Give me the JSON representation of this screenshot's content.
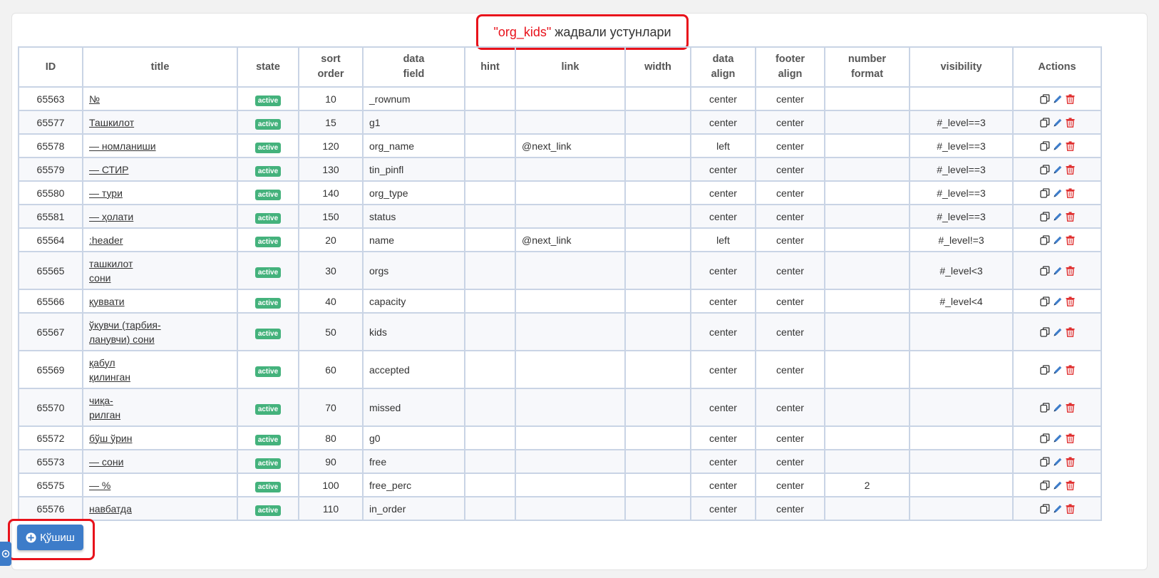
{
  "header": {
    "title_highlight": "\"org_kids\"",
    "title_rest": " жадвали устунлари"
  },
  "columns": [
    "ID",
    "title",
    "state",
    "sort\norder",
    "data\nfield",
    "hint",
    "link",
    "width",
    "data\nalign",
    "footer\nalign",
    "number\nformat",
    "visibility",
    "Actions"
  ],
  "rows": [
    {
      "id": "65563",
      "title": "№",
      "state": "active",
      "sort": "10",
      "field": "_rownum",
      "hint": "",
      "link": "",
      "width": "",
      "data_align": "center",
      "footer_align": "center",
      "number_format": "",
      "visibility": ""
    },
    {
      "id": "65577",
      "title": "Ташкилот",
      "state": "active",
      "sort": "15",
      "field": "g1",
      "hint": "",
      "link": "",
      "width": "",
      "data_align": "center",
      "footer_align": "center",
      "number_format": "",
      "visibility": "#_level==3"
    },
    {
      "id": "65578",
      "title": "— номланиши",
      "state": "active",
      "sort": "120",
      "field": "org_name",
      "hint": "",
      "link": "@next_link",
      "width": "",
      "data_align": "left",
      "footer_align": "center",
      "number_format": "",
      "visibility": "#_level==3"
    },
    {
      "id": "65579",
      "title": "— СТИР",
      "state": "active",
      "sort": "130",
      "field": "tin_pinfl",
      "hint": "",
      "link": "",
      "width": "",
      "data_align": "center",
      "footer_align": "center",
      "number_format": "",
      "visibility": "#_level==3"
    },
    {
      "id": "65580",
      "title": "— тури",
      "state": "active",
      "sort": "140",
      "field": "org_type",
      "hint": "",
      "link": "",
      "width": "",
      "data_align": "center",
      "footer_align": "center",
      "number_format": "",
      "visibility": "#_level==3"
    },
    {
      "id": "65581",
      "title": "— ҳолати",
      "state": "active",
      "sort": "150",
      "field": "status",
      "hint": "",
      "link": "",
      "width": "",
      "data_align": "center",
      "footer_align": "center",
      "number_format": "",
      "visibility": "#_level==3"
    },
    {
      "id": "65564",
      "title": ":header",
      "state": "active",
      "sort": "20",
      "field": "name",
      "hint": "",
      "link": "@next_link",
      "width": "",
      "data_align": "left",
      "footer_align": "center",
      "number_format": "",
      "visibility": "#_level!=3"
    },
    {
      "id": "65565",
      "title": "ташкилот\nсони",
      "state": "active",
      "sort": "30",
      "field": "orgs",
      "hint": "",
      "link": "",
      "width": "",
      "data_align": "center",
      "footer_align": "center",
      "number_format": "",
      "visibility": "#_level<3"
    },
    {
      "id": "65566",
      "title": "қуввати",
      "state": "active",
      "sort": "40",
      "field": "capacity",
      "hint": "",
      "link": "",
      "width": "",
      "data_align": "center",
      "footer_align": "center",
      "number_format": "",
      "visibility": "#_level<4"
    },
    {
      "id": "65567",
      "title": "ўкувчи (тарбия-\nланувчи) сони",
      "state": "active",
      "sort": "50",
      "field": "kids",
      "hint": "",
      "link": "",
      "width": "",
      "data_align": "center",
      "footer_align": "center",
      "number_format": "",
      "visibility": ""
    },
    {
      "id": "65569",
      "title": "қабул\nқилинган",
      "state": "active",
      "sort": "60",
      "field": "accepted",
      "hint": "",
      "link": "",
      "width": "",
      "data_align": "center",
      "footer_align": "center",
      "number_format": "",
      "visibility": ""
    },
    {
      "id": "65570",
      "title": "чиқа-\nрилган",
      "state": "active",
      "sort": "70",
      "field": "missed",
      "hint": "",
      "link": "",
      "width": "",
      "data_align": "center",
      "footer_align": "center",
      "number_format": "",
      "visibility": ""
    },
    {
      "id": "65572",
      "title": "бўш ўрин",
      "state": "active",
      "sort": "80",
      "field": "g0",
      "hint": "",
      "link": "",
      "width": "",
      "data_align": "center",
      "footer_align": "center",
      "number_format": "",
      "visibility": ""
    },
    {
      "id": "65573",
      "title": "— сони",
      "state": "active",
      "sort": "90",
      "field": "free",
      "hint": "",
      "link": "",
      "width": "",
      "data_align": "center",
      "footer_align": "center",
      "number_format": "",
      "visibility": ""
    },
    {
      "id": "65575",
      "title": "— %",
      "state": "active",
      "sort": "100",
      "field": "free_perc",
      "hint": "",
      "link": "",
      "width": "",
      "data_align": "center",
      "footer_align": "center",
      "number_format": "2",
      "visibility": ""
    },
    {
      "id": "65576",
      "title": "навбатда",
      "state": "active",
      "sort": "110",
      "field": "in_order",
      "hint": "",
      "link": "",
      "width": "",
      "data_align": "center",
      "footer_align": "center",
      "number_format": "",
      "visibility": ""
    }
  ],
  "actions": {
    "icons": [
      "copy-icon",
      "edit-pencil-icon",
      "delete-trash-icon"
    ]
  },
  "add_button": {
    "label": "Қўшиш",
    "icon": "plus-circle-icon"
  },
  "colors": {
    "accent": "#3d7cc9",
    "highlight_red": "#e8121b",
    "badge_green": "#44b27c"
  }
}
